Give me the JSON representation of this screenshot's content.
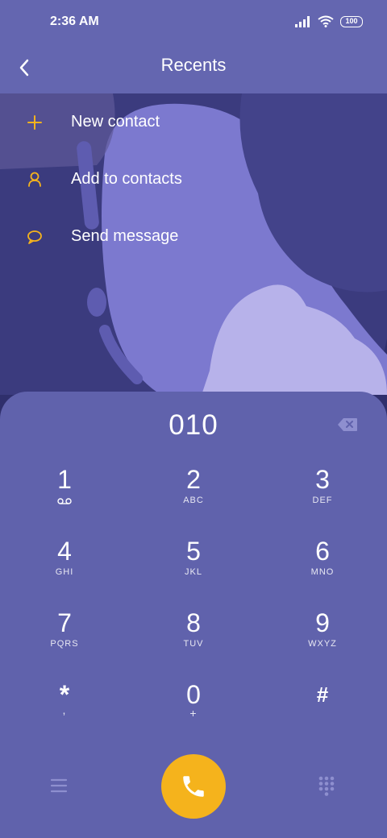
{
  "status_bar": {
    "time": "2:36 AM",
    "battery": "100"
  },
  "header": {
    "title": "Recents"
  },
  "menu": {
    "items": [
      {
        "label": "New contact",
        "icon": "plus-icon"
      },
      {
        "label": "Add to contacts",
        "icon": "person-icon"
      },
      {
        "label": "Send message",
        "icon": "chat-bubble-icon"
      }
    ]
  },
  "dialer": {
    "number": "010",
    "keys": [
      {
        "digit": "1",
        "letters": ""
      },
      {
        "digit": "2",
        "letters": "ABC"
      },
      {
        "digit": "3",
        "letters": "DEF"
      },
      {
        "digit": "4",
        "letters": "GHI"
      },
      {
        "digit": "5",
        "letters": "JKL"
      },
      {
        "digit": "6",
        "letters": "MNO"
      },
      {
        "digit": "7",
        "letters": "PQRS"
      },
      {
        "digit": "8",
        "letters": "TUV"
      },
      {
        "digit": "9",
        "letters": "WXYZ"
      },
      {
        "digit": "*",
        "letters": ","
      },
      {
        "digit": "0",
        "letters": "+"
      },
      {
        "digit": "#",
        "letters": ""
      }
    ]
  },
  "colors": {
    "accent": "#f5b31c",
    "dialer_bg": "#6062ac",
    "header_bg": "#6466b0"
  }
}
